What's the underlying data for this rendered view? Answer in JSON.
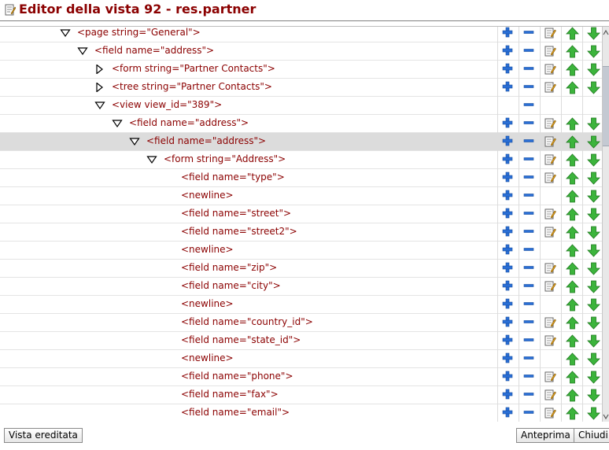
{
  "window": {
    "title": "Editor della vista 92 - res.partner",
    "icon": "edit-view-icon"
  },
  "colors": {
    "title": "#8b0000",
    "node_text": "#8b0000",
    "add": "#2a6fd6",
    "remove": "#2a6fd6",
    "up": "#3cb43c",
    "down": "#3cb43c",
    "selected_row": "#dcdcdc"
  },
  "tree": {
    "rows": [
      {
        "level": 0,
        "toggle": "expanded",
        "text": "<page string=\"General\">",
        "add": true,
        "remove": true,
        "edit": true,
        "up": true,
        "down": true,
        "selected": false
      },
      {
        "level": 1,
        "toggle": "expanded",
        "text": "<field name=\"address\">",
        "add": true,
        "remove": true,
        "edit": true,
        "up": true,
        "down": true,
        "selected": false
      },
      {
        "level": 2,
        "toggle": "collapsed",
        "text": "<form string=\"Partner Contacts\">",
        "add": true,
        "remove": true,
        "edit": true,
        "up": true,
        "down": true,
        "selected": false
      },
      {
        "level": 2,
        "toggle": "collapsed",
        "text": "<tree string=\"Partner Contacts\">",
        "add": true,
        "remove": true,
        "edit": true,
        "up": true,
        "down": true,
        "selected": false
      },
      {
        "level": 2,
        "toggle": "expanded",
        "text": "<view view_id=\"389\">",
        "add": false,
        "remove": true,
        "edit": false,
        "up": false,
        "down": false,
        "selected": false
      },
      {
        "level": 3,
        "toggle": "expanded",
        "text": "<field name=\"address\">",
        "add": true,
        "remove": true,
        "edit": true,
        "up": true,
        "down": true,
        "selected": false
      },
      {
        "level": 4,
        "toggle": "expanded",
        "text": "<field name=\"address\">",
        "add": true,
        "remove": true,
        "edit": true,
        "up": true,
        "down": true,
        "selected": true
      },
      {
        "level": 5,
        "toggle": "expanded",
        "text": "<form string=\"Address\">",
        "add": true,
        "remove": true,
        "edit": true,
        "up": true,
        "down": true,
        "selected": false
      },
      {
        "level": 6,
        "toggle": "none",
        "text": "<field name=\"type\">",
        "add": true,
        "remove": true,
        "edit": true,
        "up": true,
        "down": true,
        "selected": false
      },
      {
        "level": 6,
        "toggle": "none",
        "text": "<newline>",
        "add": true,
        "remove": true,
        "edit": false,
        "up": true,
        "down": true,
        "selected": false
      },
      {
        "level": 6,
        "toggle": "none",
        "text": "<field name=\"street\">",
        "add": true,
        "remove": true,
        "edit": true,
        "up": true,
        "down": true,
        "selected": false
      },
      {
        "level": 6,
        "toggle": "none",
        "text": "<field name=\"street2\">",
        "add": true,
        "remove": true,
        "edit": true,
        "up": true,
        "down": true,
        "selected": false
      },
      {
        "level": 6,
        "toggle": "none",
        "text": "<newline>",
        "add": true,
        "remove": true,
        "edit": false,
        "up": true,
        "down": true,
        "selected": false
      },
      {
        "level": 6,
        "toggle": "none",
        "text": "<field name=\"zip\">",
        "add": true,
        "remove": true,
        "edit": true,
        "up": true,
        "down": true,
        "selected": false
      },
      {
        "level": 6,
        "toggle": "none",
        "text": "<field name=\"city\">",
        "add": true,
        "remove": true,
        "edit": true,
        "up": true,
        "down": true,
        "selected": false
      },
      {
        "level": 6,
        "toggle": "none",
        "text": "<newline>",
        "add": true,
        "remove": true,
        "edit": false,
        "up": true,
        "down": true,
        "selected": false
      },
      {
        "level": 6,
        "toggle": "none",
        "text": "<field name=\"country_id\">",
        "add": true,
        "remove": true,
        "edit": true,
        "up": true,
        "down": true,
        "selected": false
      },
      {
        "level": 6,
        "toggle": "none",
        "text": "<field name=\"state_id\">",
        "add": true,
        "remove": true,
        "edit": true,
        "up": true,
        "down": true,
        "selected": false
      },
      {
        "level": 6,
        "toggle": "none",
        "text": "<newline>",
        "add": true,
        "remove": true,
        "edit": false,
        "up": true,
        "down": true,
        "selected": false
      },
      {
        "level": 6,
        "toggle": "none",
        "text": "<field name=\"phone\">",
        "add": true,
        "remove": true,
        "edit": true,
        "up": true,
        "down": true,
        "selected": false
      },
      {
        "level": 6,
        "toggle": "none",
        "text": "<field name=\"fax\">",
        "add": true,
        "remove": true,
        "edit": true,
        "up": true,
        "down": true,
        "selected": false
      },
      {
        "level": 6,
        "toggle": "none",
        "text": "<field name=\"email\">",
        "add": true,
        "remove": true,
        "edit": true,
        "up": true,
        "down": true,
        "selected": false
      }
    ]
  },
  "footer": {
    "inherited_view_label": "Vista ereditata",
    "preview_label": "Anteprima",
    "close_label": "Chiudi"
  }
}
